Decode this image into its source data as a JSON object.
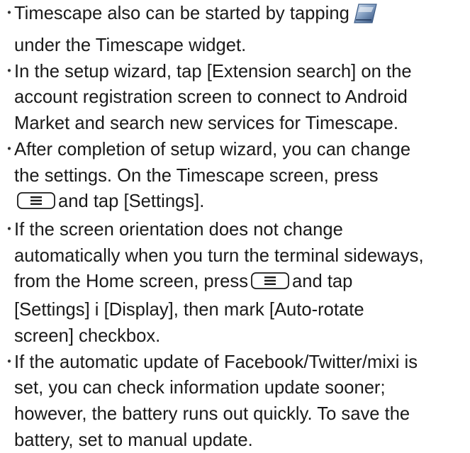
{
  "notes": [
    {
      "lines": [
        {
          "before": "Timescape also can be started by tapping",
          "icon": "timescape-app-icon"
        },
        {
          "text": "under the Timescape widget."
        }
      ]
    },
    {
      "lines": [
        {
          "text": "In the setup wizard, tap [Extension search] on the"
        },
        {
          "text": "account registration screen to connect to Android"
        },
        {
          "text": "Market and search new services for Timescape."
        }
      ]
    },
    {
      "lines": [
        {
          "text": "After completion of setup wizard, you can change"
        },
        {
          "text": "the settings. On the Timescape screen, press"
        },
        {
          "key": "menu-key-icon",
          "after": "and tap [Settings]."
        }
      ]
    },
    {
      "lines": [
        {
          "text": "If the screen orientation does not change"
        },
        {
          "text": "automatically when you turn the terminal sideways,"
        },
        {
          "before": "from the Home screen, press",
          "key": "menu-key-icon",
          "after": "and tap"
        },
        {
          "text": "[Settings] i  [Display], then mark [Auto-rotate"
        },
        {
          "text": "screen] checkbox."
        }
      ]
    },
    {
      "lines": [
        {
          "text": "If the automatic update of Facebook/Twitter/mixi is"
        },
        {
          "text": "set, you can check information update sooner;"
        },
        {
          "text": "however, the battery runs out quickly. To save the"
        },
        {
          "text": "battery, set to manual update."
        }
      ]
    }
  ],
  "bullet_char": "・"
}
